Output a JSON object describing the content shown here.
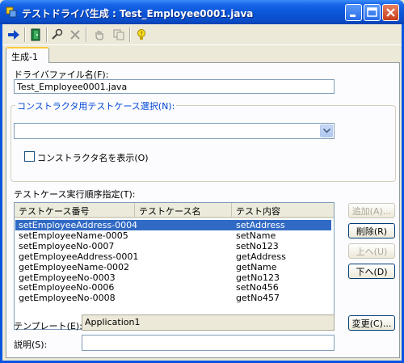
{
  "window": {
    "title": "テストドライバ生成 : Test_Employee0001.java"
  },
  "toolbar": {
    "icons": [
      "arrow-right-icon",
      "exit-door-icon",
      "wand-icon",
      "delete-x-icon",
      "hand-icon",
      "copy-icon",
      "help-bulb-icon"
    ]
  },
  "tabs": [
    {
      "label": "生成-1"
    }
  ],
  "form": {
    "driver_file_label": "ドライバファイル名(F):",
    "driver_file_value": "Test_Employee0001.java",
    "ctor_group_label": "コンストラクタ用テストケース選択(N):",
    "ctor_combo_value": "",
    "show_ctor_label": "コンストラクタ名を表示(O)",
    "exec_order_label": "テストケース実行順序指定(T):",
    "template_label": "テンプレート(E):",
    "template_value": "Application1",
    "description_label": "説明(S):",
    "description_value": ""
  },
  "table": {
    "columns": [
      "テストケース番号",
      "テストケース名",
      "テスト内容"
    ],
    "rows": [
      {
        "id": "setEmployeeAddress-0004",
        "name": "",
        "content": "setAddress",
        "selected": true
      },
      {
        "id": "setEmployeeName-0005",
        "name": "",
        "content": "setName",
        "selected": false
      },
      {
        "id": "setEmployeeNo-0007",
        "name": "",
        "content": "setNo123",
        "selected": false
      },
      {
        "id": "getEmployeeAddress-0001",
        "name": "",
        "content": "getAddress",
        "selected": false
      },
      {
        "id": "getEmployeeName-0002",
        "name": "",
        "content": "getName",
        "selected": false
      },
      {
        "id": "getEmployeeNo-0003",
        "name": "",
        "content": "getNo123",
        "selected": false
      },
      {
        "id": "setEmployeeNo-0006",
        "name": "",
        "content": "setNo456",
        "selected": false
      },
      {
        "id": "getEmployeeNo-0008",
        "name": "",
        "content": "getNo457",
        "selected": false
      }
    ]
  },
  "buttons": {
    "add": "追加(A)...",
    "delete": "削除(R)",
    "up": "上へ(U)",
    "down": "下へ(D)",
    "change": "変更(C)..."
  }
}
